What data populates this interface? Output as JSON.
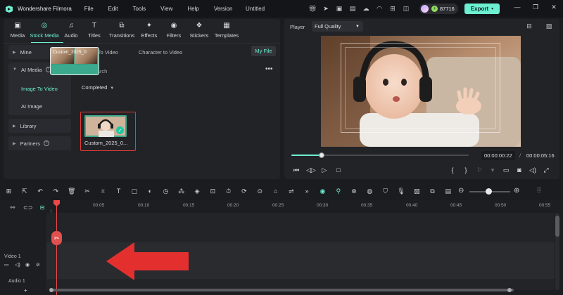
{
  "titlebar": {
    "app_title": "Wondershare Filmora",
    "menu": [
      "File",
      "Edit",
      "Tools",
      "View",
      "Help",
      "Version"
    ],
    "document_title": "Untitled",
    "credits": "87716",
    "export_label": "Export"
  },
  "media_tabs": [
    {
      "label": "Media",
      "icon": "folder-icon",
      "glyph": "▣"
    },
    {
      "label": "Stock Media",
      "icon": "stock-media-icon",
      "glyph": "◎"
    },
    {
      "label": "Audio",
      "icon": "music-icon",
      "glyph": "♫"
    },
    {
      "label": "Titles",
      "icon": "text-icon",
      "glyph": "T"
    },
    {
      "label": "Transitions",
      "icon": "transitions-icon",
      "glyph": "⧉"
    },
    {
      "label": "Effects",
      "icon": "effects-icon",
      "glyph": "✦"
    },
    {
      "label": "Filters",
      "icon": "filters-icon",
      "glyph": "◉"
    },
    {
      "label": "Stickers",
      "icon": "stickers-icon",
      "glyph": "❖"
    },
    {
      "label": "Templates",
      "icon": "templates-icon",
      "glyph": "▦"
    }
  ],
  "sidebar": {
    "mine": "Mine",
    "ai_media": "AI Media",
    "ai_badge": "AI",
    "image_to_video": "Image To Video",
    "ai_image": "AI Image",
    "library": "Library",
    "partners": "Partners"
  },
  "content": {
    "subtab_1": "Image To Video",
    "subtab_2": "Character to Video",
    "my_file": "My File",
    "search_placeholder": "Search",
    "section": "Completed",
    "item_name": "Custom_2025_0..."
  },
  "player": {
    "label": "Player",
    "quality": "Full Quality",
    "current_time": "00:00:00:22",
    "separator": "/",
    "total_time": "00:00:05:16",
    "progress": 0.17
  },
  "timeline": {
    "ruler": [
      "00:05",
      "00:10",
      "00:15",
      "00:20",
      "00:25",
      "00:30",
      "00:35",
      "00:40",
      "00:45",
      "00:50",
      "00:55"
    ],
    "video_track": "Video 1",
    "audio_track": "Audio 1",
    "clip_label": "Custom_2025_0",
    "add_track": "+"
  },
  "colors": {
    "accent": "#6df0d2",
    "highlight_border": "#e23a3a",
    "playhead": "#f04848",
    "clip": "#3aa98c",
    "arrow": "#e3302f"
  }
}
